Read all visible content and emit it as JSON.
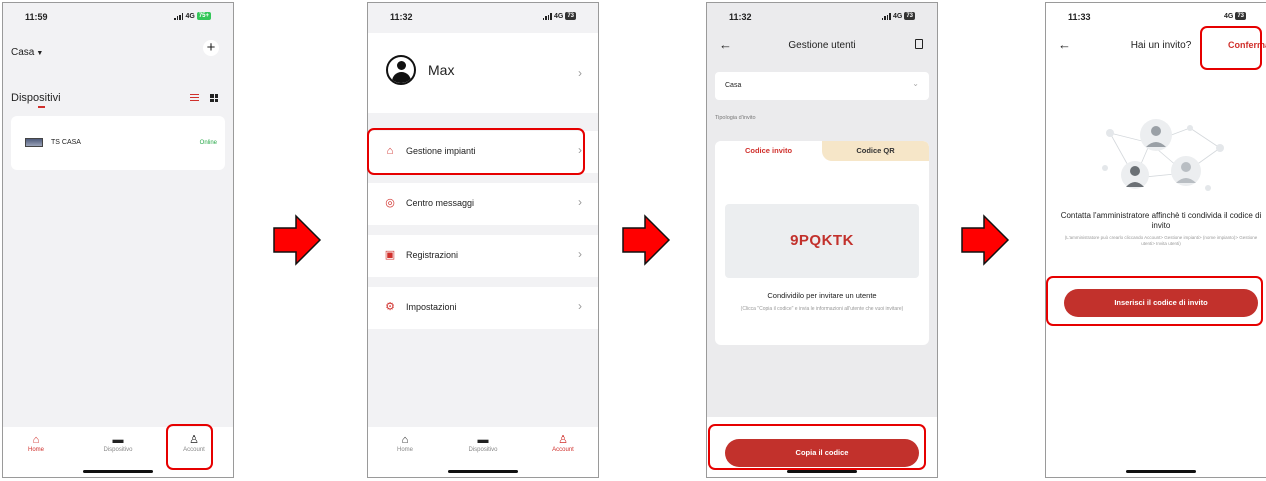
{
  "phone1": {
    "time": "11:59",
    "network": "4G",
    "battery": "75+",
    "home_selector": "Casa",
    "section_title": "Dispositivi",
    "device": {
      "name": "TS CASA",
      "status": "Online"
    },
    "tabs": [
      {
        "label": "Home",
        "icon": "home-icon"
      },
      {
        "label": "Dispositivo",
        "icon": "device-icon"
      },
      {
        "label": "Account",
        "icon": "account-icon"
      }
    ]
  },
  "phone2": {
    "time": "11:32",
    "network": "4G",
    "battery": "73",
    "username": "Max",
    "menu": [
      {
        "label": "Gestione impianti",
        "icon": "home-icon"
      },
      {
        "label": "Centro messaggi",
        "icon": "message-icon"
      },
      {
        "label": "Registrazioni",
        "icon": "recording-icon"
      },
      {
        "label": "Impostazioni",
        "icon": "settings-icon"
      }
    ],
    "tabs": [
      {
        "label": "Home"
      },
      {
        "label": "Dispositivo"
      },
      {
        "label": "Account"
      }
    ]
  },
  "phone3": {
    "time": "11:32",
    "network": "4G",
    "battery": "73",
    "title": "Gestione utenti",
    "selected_home": "Casa",
    "invite_type_label": "Tipologia d'invito",
    "tab_code": "Codice invito",
    "tab_qr": "Codice QR",
    "invite_code": "9PQKTK",
    "share_text": "Condividilo per invitare un utente",
    "hint_text": "(Clicca \"Copia il codice\" e invia le informazioni all'utente che vuoi invitare)",
    "copy_button": "Copia il codice"
  },
  "phone4": {
    "time": "11:33",
    "network": "4G",
    "battery": "73",
    "title": "Hai un invito?",
    "confirm": "Conferma",
    "message": "Contatta l'amministratore affinchè ti condivida il codice di invito",
    "sub_message": "(L'amministratore può crearlo cliccando Account> Gestione impianti> (nome impianto)> Gestione utenti> Invita utenti)",
    "enter_button": "Inserisci il codice di invito"
  },
  "colors": {
    "accent": "#c2312c",
    "highlight": "#e60000",
    "arrow": "#ff0000"
  }
}
